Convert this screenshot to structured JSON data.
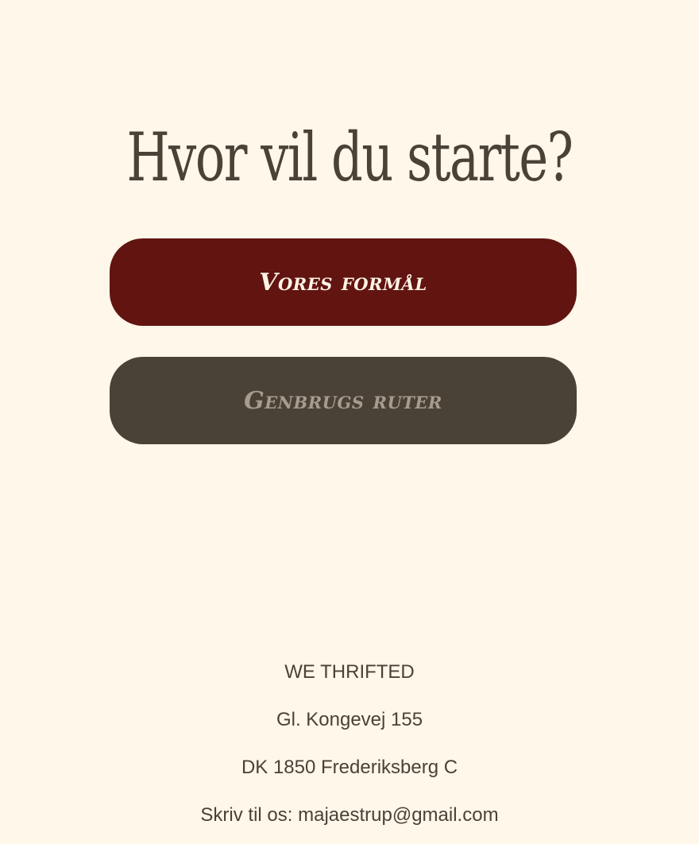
{
  "main": {
    "heading": "Hvor vil du starte?",
    "buttons": [
      {
        "label": "Vores formål",
        "background": "#611410",
        "text_color": "#fff4e6"
      },
      {
        "label": "Genbrugs ruter",
        "background": "#4a4237",
        "text_color": "#a69d8f"
      }
    ]
  },
  "footer": {
    "brand": "WE THRIFTED",
    "address_line1": "Gl. Kongevej 155",
    "address_line2": "DK 1850 Frederiksberg C",
    "contact_prefix": "Skriv til os:",
    "email": "majaestrup@gmail.com"
  },
  "colors": {
    "background": "#fff7ea",
    "text": "#4a4237"
  }
}
